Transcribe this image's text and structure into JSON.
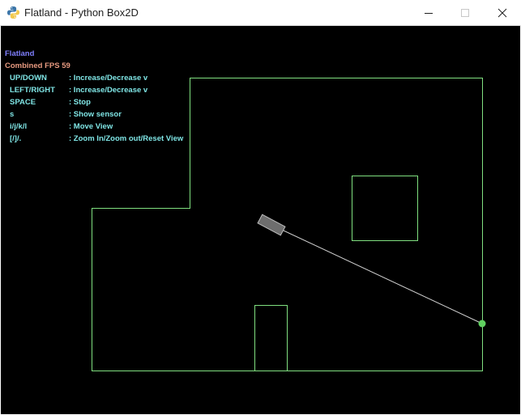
{
  "window": {
    "title": "Flatland - Python Box2D",
    "app_icon": "python-icon",
    "controls": [
      "minimize-icon",
      "maximize-icon",
      "close-icon"
    ]
  },
  "hud": {
    "title": "Flatland",
    "fps_text": "Combined FPS 59",
    "colors": {
      "title": "#8080ff",
      "fps": "#e89a80",
      "help": "#7fe5e5"
    },
    "help": [
      {
        "key": "UP/DOWN",
        "desc": ": Increase/Decrease v"
      },
      {
        "key": "LEFT/RIGHT",
        "desc": ": Increase/Decrease v"
      },
      {
        "key": "SPACE",
        "desc": ": Stop"
      },
      {
        "key": "s",
        "desc": ": Show sensor"
      },
      {
        "key": "i/j/k/l",
        "desc": ": Move View"
      },
      {
        "key": "[/]/.",
        "desc": ": Zoom In/Zoom out/Reset View"
      }
    ]
  },
  "scene": {
    "background": "#000000",
    "wall_color": "#80e080",
    "robot_color": "#7a7a7a",
    "sensor_ray_color": "#d0d0d0",
    "sensor_hit_color": "#60d060"
  }
}
